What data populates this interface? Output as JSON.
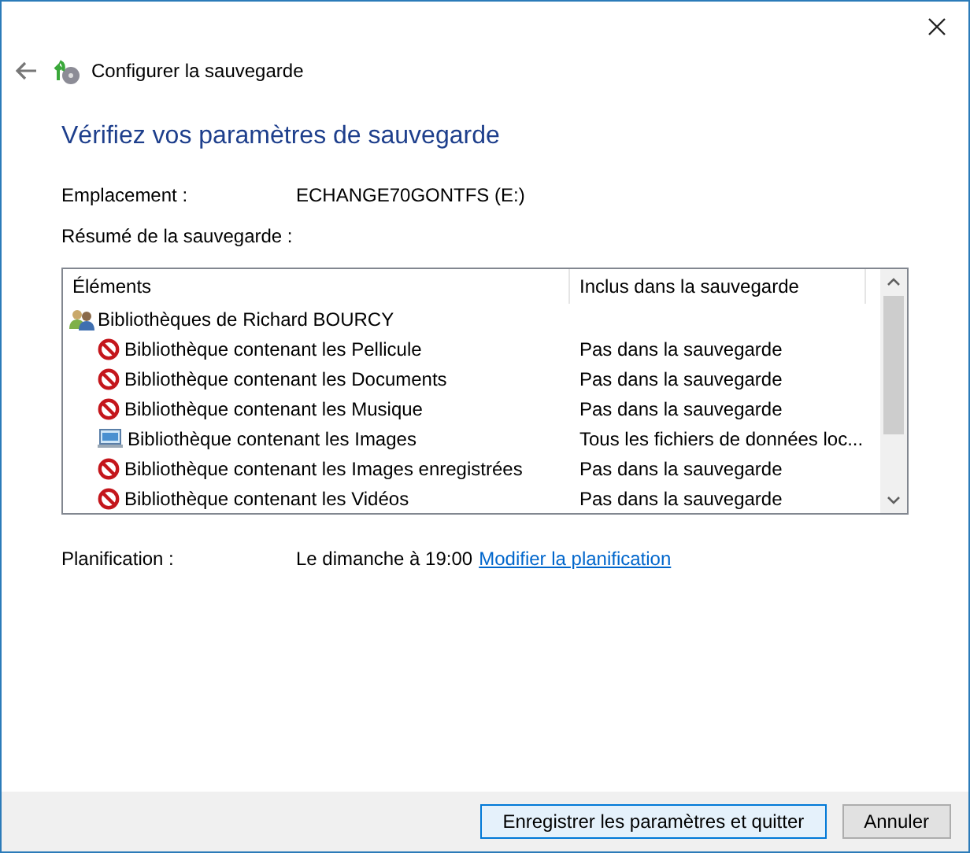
{
  "window": {
    "title": "Configurer la sauvegarde"
  },
  "heading": "Vérifiez vos paramètres de sauvegarde",
  "location": {
    "label": "Emplacement :",
    "value": "ECHANGE70GONTFS (E:)"
  },
  "summary_label": "Résumé de la sauvegarde :",
  "table": {
    "columns": [
      "Éléments",
      "Inclus dans la sauvegarde"
    ],
    "group": {
      "name": "Bibliothèques de Richard BOURCY",
      "children": [
        {
          "name": "Bibliothèque contenant les Pellicule",
          "included": "Pas dans la sauvegarde",
          "kind": "excluded"
        },
        {
          "name": "Bibliothèque contenant les Documents",
          "included": "Pas dans la sauvegarde",
          "kind": "excluded"
        },
        {
          "name": "Bibliothèque contenant les Musique",
          "included": "Pas dans la sauvegarde",
          "kind": "excluded"
        },
        {
          "name": "Bibliothèque contenant les Images",
          "included": "Tous les fichiers de données loc...",
          "kind": "included"
        },
        {
          "name": "Bibliothèque contenant les Images enregistrées",
          "included": "Pas dans la sauvegarde",
          "kind": "excluded"
        },
        {
          "name": "Bibliothèque contenant les Vidéos",
          "included": "Pas dans la sauvegarde",
          "kind": "excluded"
        }
      ]
    }
  },
  "schedule": {
    "label": "Planification :",
    "value": "Le dimanche à 19:00",
    "link": "Modifier la planification"
  },
  "buttons": [
    "Enregistrer les paramètres et quitter",
    "Annuler"
  ]
}
